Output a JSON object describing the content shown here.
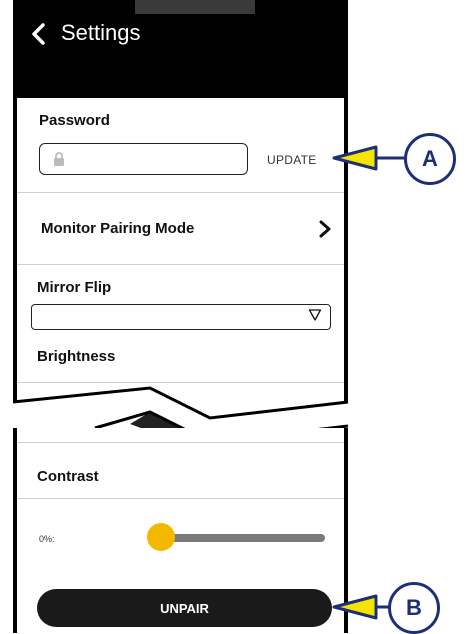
{
  "header": {
    "title": "Settings"
  },
  "settings": {
    "password_label": "Password",
    "update_label": "UPDATE",
    "monitor_pairing_label": "Monitor Pairing Mode",
    "mirror_flip_label": "Mirror Flip",
    "mirror_flip_value": "",
    "brightness_label": "Brightness",
    "contrast_label": "Contrast",
    "contrast_value_label": "0%:",
    "contrast_level": 0
  },
  "actions": {
    "unpair_label": "UNPAIR"
  },
  "callouts": {
    "a": "A",
    "b": "B"
  },
  "colors": {
    "accent": "#f5b800",
    "callout": "#1e2f7a",
    "header": "#000000"
  },
  "icons": [
    "chevron-left-icon",
    "lock-icon",
    "chevron-right-icon",
    "triangle-down-icon"
  ]
}
